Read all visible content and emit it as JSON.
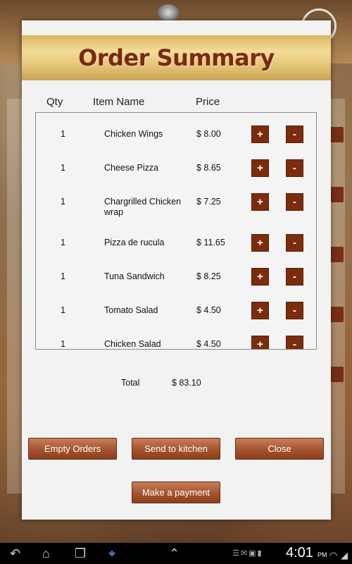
{
  "dialog": {
    "title": "Order Summary",
    "columns": {
      "qty": "Qty",
      "item_name": "Item Name",
      "price": "Price"
    },
    "items": [
      {
        "qty": "1",
        "name": "Chicken Wings",
        "price": "$ 8.00"
      },
      {
        "qty": "1",
        "name": "Cheese Pizza",
        "price": "$ 8.65"
      },
      {
        "qty": "1",
        "name": "Chargrilled Chicken wrap",
        "price": "$ 7.25"
      },
      {
        "qty": "1",
        "name": "Pizza de rucula",
        "price": "$ 11.65"
      },
      {
        "qty": "1",
        "name": "Tuna Sandwich",
        "price": "$ 8.25"
      },
      {
        "qty": "1",
        "name": "Tomato Salad",
        "price": "$ 4.50"
      },
      {
        "qty": "1",
        "name": "Chicken Salad",
        "price": "$ 4.50"
      }
    ],
    "plus_label": "+",
    "minus_label": "-",
    "total_label": "Total",
    "total_value": "$ 83.10",
    "buttons": {
      "empty_orders": "Empty Orders",
      "send_to_kitchen": "Send to kitchen",
      "close": "Close",
      "make_payment": "Make a payment"
    }
  },
  "colors": {
    "accent": "#7b2c0c",
    "header_gold": "#e6c77a",
    "title_text": "#7a2a10"
  },
  "status_bar": {
    "time": "4:01",
    "ampm": "PM",
    "icons": [
      "back-icon",
      "home-icon",
      "recent-apps-icon",
      "screenshot-icon",
      "up-arrow-icon",
      "usb-icon",
      "mail-icon",
      "battery-icon",
      "wifi-icon",
      "signal-icon"
    ]
  }
}
